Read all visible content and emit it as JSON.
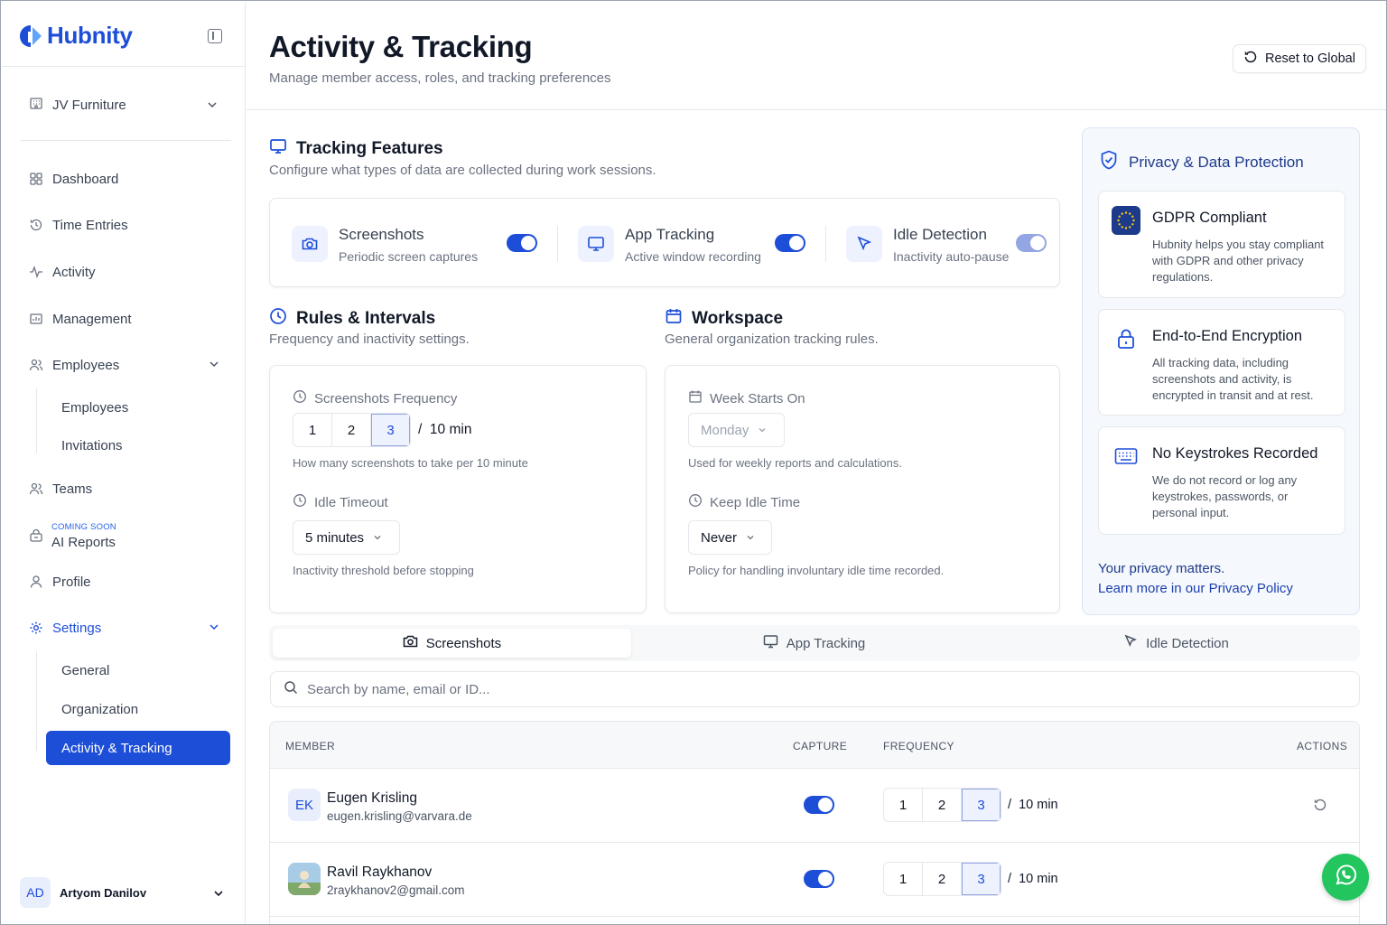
{
  "app": {
    "name": "Hubnity"
  },
  "sidebar": {
    "org": "JV Furniture",
    "nav": {
      "dashboard": "Dashboard",
      "time_entries": "Time Entries",
      "activity": "Activity",
      "management": "Management",
      "employees": "Employees",
      "employees_sub": [
        "Employees",
        "Invitations"
      ],
      "teams": "Teams",
      "coming_soon": "COMING SOON",
      "ai_reports": "AI Reports",
      "profile": "Profile",
      "settings": "Settings",
      "settings_sub": [
        "General",
        "Organization",
        "Activity & Tracking"
      ]
    },
    "user": {
      "initials": "AD",
      "name": "Artyom Danilov"
    }
  },
  "header": {
    "title": "Activity & Tracking",
    "subtitle": "Manage member access, roles, and tracking preferences",
    "reset_label": "Reset to Global"
  },
  "tracking_features": {
    "title": "Tracking Features",
    "subtitle": "Configure what types of data are collected during work sessions.",
    "items": [
      {
        "title": "Screenshots",
        "subtitle": "Periodic screen captures",
        "enabled": true
      },
      {
        "title": "App Tracking",
        "subtitle": "Active window recording",
        "enabled": true
      },
      {
        "title": "Idle Detection",
        "subtitle": "Inactivity auto-pause",
        "enabled": true
      }
    ]
  },
  "rules": {
    "title": "Rules & Intervals",
    "subtitle": "Frequency and inactivity settings.",
    "screenshots_frequency": {
      "label": "Screenshots Frequency",
      "options": [
        "1",
        "2",
        "3"
      ],
      "selected": "3",
      "unit": "/  10 min",
      "help": "How many screenshots to take per 10 minute"
    },
    "idle_timeout": {
      "label": "Idle Timeout",
      "value": "5 minutes",
      "help": "Inactivity threshold before stopping"
    }
  },
  "workspace": {
    "title": "Workspace",
    "subtitle": "General organization tracking rules.",
    "week_starts_on": {
      "label": "Week Starts On",
      "value": "Monday",
      "help": "Used for weekly reports and calculations."
    },
    "keep_idle_time": {
      "label": "Keep Idle Time",
      "value": "Never",
      "help": "Policy for handling involuntary idle time recorded."
    }
  },
  "privacy": {
    "title": "Privacy & Data Protection",
    "cards": [
      {
        "title": "GDPR Compliant",
        "desc": "Hubnity helps you stay compliant with GDPR and other privacy regulations."
      },
      {
        "title": "End-to-End Encryption",
        "desc": "All tracking data, including screenshots and activity, is encrypted in transit and at rest."
      },
      {
        "title": "No Keystrokes Recorded",
        "desc": "We do not record or log any keystrokes, passwords, or personal input."
      }
    ],
    "footer_line1": "Your privacy matters.",
    "footer_line2": "Learn more in our Privacy Policy"
  },
  "tabs": [
    "Screenshots",
    "App Tracking",
    "Idle Detection"
  ],
  "active_tab": "Screenshots",
  "search": {
    "placeholder": "Search by name, email or ID..."
  },
  "table": {
    "columns": [
      "MEMBER",
      "CAPTURE",
      "FREQUENCY",
      "ACTIONS"
    ],
    "rows": [
      {
        "initials": "EK",
        "name": "Eugen Krisling",
        "email": "eugen.krisling@varvara.de",
        "capture": true,
        "options": [
          "1",
          "2",
          "3"
        ],
        "selected": "3",
        "unit": "/  10 min"
      },
      {
        "initials": "",
        "name": "Ravil Raykhanov",
        "email": "2raykhanov2@gmail.com",
        "capture": true,
        "options": [
          "1",
          "2",
          "3"
        ],
        "selected": "3",
        "unit": "/  10 min"
      }
    ]
  },
  "colors": {
    "accent": "#1d4ed8",
    "whatsapp": "#22c55e"
  }
}
